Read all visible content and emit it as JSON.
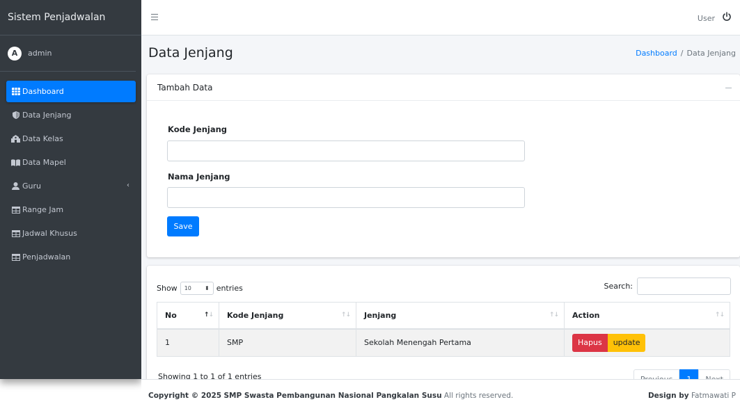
{
  "sidebar": {
    "brand": "Sistem Penjadwalan",
    "user": "admin",
    "items": [
      {
        "label": "Dashboard",
        "icon": "table-icon"
      },
      {
        "label": "Data Jenjang",
        "icon": "shield-icon"
      },
      {
        "label": "Data Kelas",
        "icon": "school-icon"
      },
      {
        "label": "Data Mapel",
        "icon": "book-icon"
      },
      {
        "label": "Guru",
        "icon": "user-icon"
      },
      {
        "label": "Range Jam",
        "icon": "table-icon"
      },
      {
        "label": "Jadwal Khusus",
        "icon": "table-icon"
      },
      {
        "label": "Penjadwalan",
        "icon": "table-icon"
      }
    ],
    "submenu_arrow": "‹"
  },
  "topbar": {
    "user_label": "User"
  },
  "page": {
    "title": "Data Jenjang",
    "breadcrumb": {
      "home": "Dashboard",
      "current": "Data Jenjang",
      "separator": "/"
    }
  },
  "form": {
    "card_title": "Tambah Data",
    "kode_label": "Kode Jenjang",
    "kode_value": "",
    "nama_label": "Nama Jenjang",
    "nama_value": "",
    "save_label": "Save"
  },
  "table": {
    "show_label": "Show",
    "entries_value": "10",
    "entries_label": "entries",
    "search_label": "Search:",
    "columns": [
      "No",
      "Kode Jenjang",
      "Jenjang",
      "Action"
    ],
    "rows": [
      {
        "no": "1",
        "kode": "SMP",
        "jenjang": "Sekolah Menengah Pertama",
        "hapus": "Hapus",
        "update": "update"
      }
    ],
    "info": "Showing 1 to 1 of 1 entries",
    "pagination": {
      "previous": "Previous",
      "current": "1",
      "next": "Next"
    }
  },
  "footer": {
    "copyright_prefix": "Copyright © 2025",
    "org": "SMP Swasta Pembangunan Nasional Pangkalan Susu",
    "rights": "All rights reserved.",
    "design_by_label": "Design by",
    "designer": "Fatmawati P"
  },
  "colors": {
    "sidebar_bg": "#343a40",
    "primary": "#007bff",
    "danger": "#dc3545",
    "warning": "#ffc107",
    "content_bg": "#f4f6f9"
  }
}
